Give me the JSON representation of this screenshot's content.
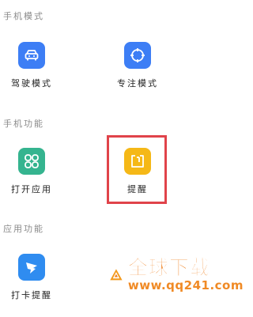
{
  "sections": {
    "phone_mode": "手机模式",
    "phone_function": "手机功能",
    "app_function": "应用功能"
  },
  "tiles": {
    "driving_mode": {
      "label": "驾驶模式",
      "icon": "car-icon",
      "color": "#3d7ef5"
    },
    "focus_mode": {
      "label": "专注模式",
      "icon": "target-icon",
      "color": "#3d7ef5"
    },
    "open_app": {
      "label": "打开应用",
      "icon": "grid-icon",
      "color": "#35b48f"
    },
    "reminder": {
      "label": "提醒",
      "icon": "reminder-icon",
      "color": "#f5b817"
    },
    "check_in": {
      "label": "打卡提醒",
      "icon": "dingtalk-icon",
      "color": "#2f8cf0"
    }
  },
  "highlight_color": "#e0434a",
  "watermark": {
    "title": "全球下载",
    "url": "www.qq241.com",
    "color": "#ef7d1a"
  }
}
